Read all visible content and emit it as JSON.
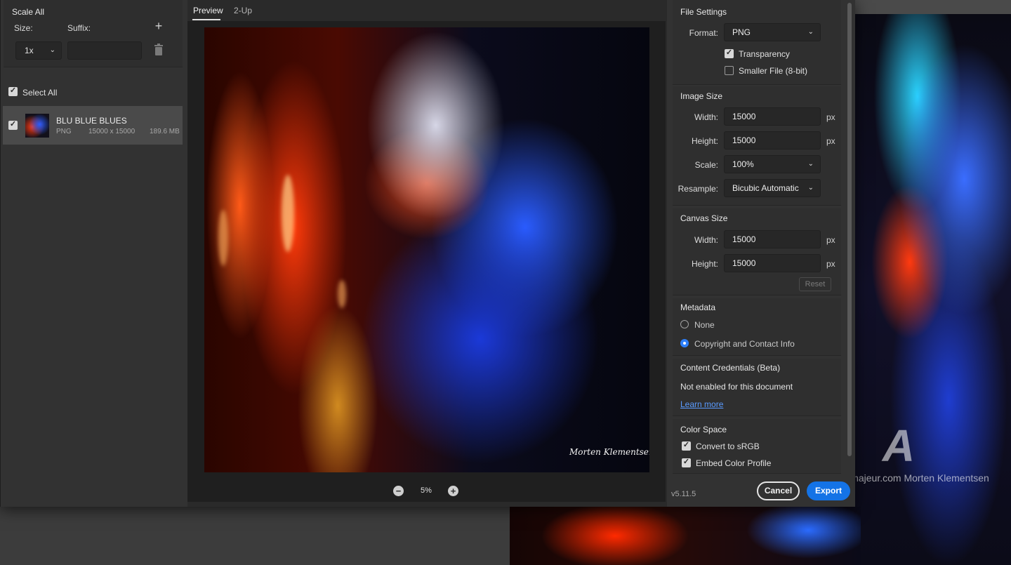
{
  "left_panel": {
    "scale_title": "Scale All",
    "size_label": "Size:",
    "suffix_label": "Suffix:",
    "size_value": "1x",
    "suffix_value": "",
    "select_all_label": "Select All",
    "asset": {
      "name": "BLU BLUE BLUES",
      "format": "PNG",
      "dimensions": "15000 x 15000",
      "file_size": "189.6 MB"
    }
  },
  "preview": {
    "tabs": [
      {
        "label": "Preview",
        "active": true
      },
      {
        "label": "2-Up",
        "active": false
      }
    ],
    "zoom": "5%",
    "signature": "Morten Klementsen"
  },
  "file_settings": {
    "title": "File Settings",
    "format_label": "Format:",
    "format_value": "PNG",
    "transparency_label": "Transparency",
    "transparency_checked": true,
    "smaller_file_label": "Smaller File (8-bit)",
    "smaller_file_checked": false
  },
  "image_size": {
    "title": "Image Size",
    "width_label": "Width:",
    "width_value": "15000",
    "height_label": "Height:",
    "height_value": "15000",
    "scale_label": "Scale:",
    "scale_value": "100%",
    "resample_label": "Resample:",
    "resample_value": "Bicubic Automatic",
    "unit": "px"
  },
  "canvas_size": {
    "title": "Canvas Size",
    "width_label": "Width:",
    "width_value": "15000",
    "height_label": "Height:",
    "height_value": "15000",
    "unit": "px",
    "reset_label": "Reset"
  },
  "metadata": {
    "title": "Metadata",
    "options": [
      {
        "label": "None",
        "selected": false
      },
      {
        "label": "Copyright and Contact Info",
        "selected": true
      }
    ]
  },
  "content_credentials": {
    "title": "Content Credentials (Beta)",
    "status": "Not enabled for this document",
    "link": "Learn more"
  },
  "color_space": {
    "title": "Color Space",
    "convert_label": "Convert to sRGB",
    "convert_checked": true,
    "embed_label": "Embed Color Profile",
    "embed_checked": true
  },
  "footer": {
    "version": "v5.11.5",
    "cancel_label": "Cancel",
    "export_label": "Export"
  },
  "background": {
    "watermark_text": "©Artmajeur.com Morten Klementsen"
  },
  "colors": {
    "accent": "#1473e6",
    "radio_selected": "#2d7ff9",
    "link": "#5a9bff"
  }
}
